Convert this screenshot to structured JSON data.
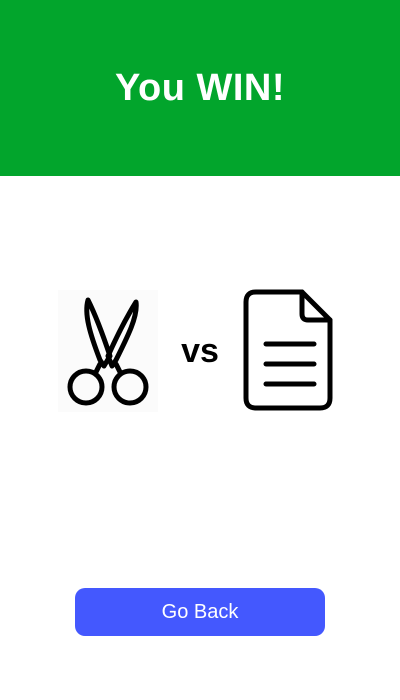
{
  "result": {
    "title": "You WIN!",
    "banner_color": "#02a52c"
  },
  "matchup": {
    "player_choice": "scissors",
    "player_icon": "scissors-icon",
    "vs_label": "vs",
    "opponent_choice": "paper",
    "opponent_icon": "paper-document-icon"
  },
  "actions": {
    "go_back_label": "Go Back",
    "button_color": "#4458fe"
  }
}
